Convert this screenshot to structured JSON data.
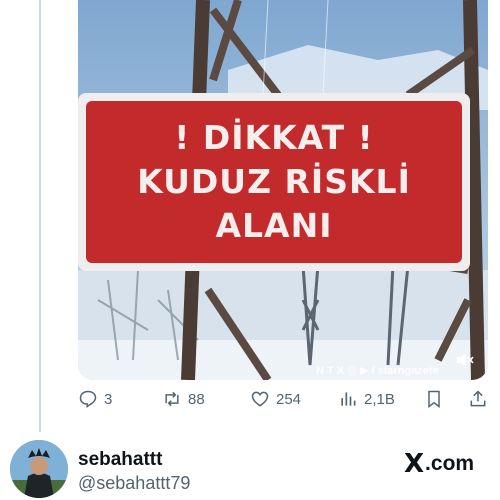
{
  "media": {
    "sign_lines": [
      "! DİKKAT !",
      "KUDUZ RİSKLİ",
      "ALANI"
    ],
    "watermark": "N T X  ◎ ▶ / starngazete",
    "mute_icon": "speaker-muted-icon"
  },
  "actions": {
    "replies": "3",
    "reposts": "88",
    "likes": "254",
    "views": "2,1B"
  },
  "author": {
    "name": "sebahattt",
    "handle": "@sebahattt79"
  },
  "brand": {
    "domain": "com",
    "x": "X"
  },
  "colors": {
    "sign_red": "#c22a2c",
    "icon_gray": "#536471"
  }
}
